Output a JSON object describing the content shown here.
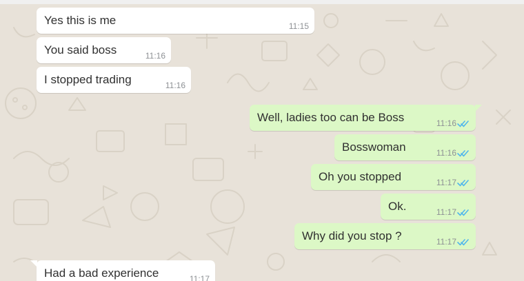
{
  "colors": {
    "chat_background": "#e8e2d9",
    "incoming_bubble": "#ffffff",
    "outgoing_bubble": "#dcf8c6",
    "read_ticks": "#4fb6ec"
  },
  "messages": [
    {
      "direction": "incoming",
      "text": "Yes this is me",
      "time": "11:15"
    },
    {
      "direction": "incoming",
      "text": "You said boss",
      "time": "11:16"
    },
    {
      "direction": "incoming",
      "text": "I stopped trading",
      "time": "11:16"
    },
    {
      "direction": "outgoing",
      "text": "Well, ladies too can be Boss",
      "time": "11:16",
      "status": "read-ticks-icon"
    },
    {
      "direction": "outgoing",
      "text": "Bosswoman",
      "time": "11:16",
      "status": "read-ticks-icon"
    },
    {
      "direction": "outgoing",
      "text": "Oh you stopped",
      "time": "11:17",
      "status": "read-ticks-icon"
    },
    {
      "direction": "outgoing",
      "text": "Ok.",
      "time": "11:17",
      "status": "read-ticks-icon"
    },
    {
      "direction": "outgoing",
      "text": "Why did you stop ?",
      "time": "11:17",
      "status": "read-ticks-icon"
    },
    {
      "direction": "incoming",
      "text": "Had a bad experience",
      "time": "11:17"
    }
  ]
}
